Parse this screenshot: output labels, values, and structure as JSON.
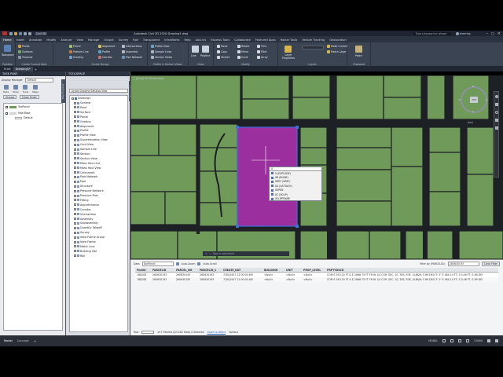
{
  "app": {
    "title": "Autodesk Civil 3D 2020    Drawing1.dwg",
    "search_placeholder": "Type a keyword or phrase",
    "user": "cheerlng",
    "product_badge": "Civil 3D"
  },
  "ribbon_tabs": [
    "Home",
    "Insert",
    "Annotate",
    "Modify",
    "Analyze",
    "View",
    "Manage",
    "Output",
    "Survey",
    "Rail",
    "Transparent",
    "InfraWorks",
    "Help",
    "Add-ins",
    "Express Tools",
    "Collaborate",
    "Featured Apps",
    "Raster Tools",
    "Vehicle Tracking",
    "Geolocation"
  ],
  "ribbon_active_tab": "Home",
  "ribbon": {
    "palettes": {
      "toolspace": "Toolspace",
      "label": "Palettes"
    },
    "ground_data": {
      "items": [
        "Points",
        "Surfaces",
        "Traverse"
      ],
      "label": "Create Ground Data"
    },
    "design": {
      "items": [
        "Parcel",
        "Feature Line",
        "Grading",
        "Alignment",
        "Profile",
        "Corridor",
        "Intersections",
        "Assembly",
        "Pipe Network"
      ],
      "label": "Create Design"
    },
    "profile_section": {
      "items": [
        "Profile View",
        "Sample Lines",
        "Section Views"
      ],
      "label": "Profile & Section Views"
    },
    "draw": {
      "items": [
        "Line",
        "Polyline",
        "Circle",
        "Arc"
      ],
      "label": "Draw"
    },
    "modify": {
      "items": [
        "Move",
        "Copy",
        "Stretch",
        "Rotate",
        "Mirror",
        "Scale",
        "Trim",
        "Fillet",
        "Array"
      ],
      "label": "Modify"
    },
    "layers": {
      "items": [
        "Layer Properties",
        "Make Current",
        "Match Layer"
      ],
      "label": "Layers"
    },
    "clipboard": {
      "items": [
        "Paste"
      ],
      "label": "Clipboard"
    }
  },
  "doc_tabs": [
    "Start",
    "Drawing1*"
  ],
  "taskpane": {
    "title": "TASK PANE",
    "display_manager_label": "Display Manager",
    "map_label": "Default",
    "tools": [
      "Data",
      "Style",
      "Tools",
      "Maps"
    ],
    "buttons": [
      "Groups",
      "Draw Order"
    ],
    "layers": [
      {
        "name": "TaxParcel"
      },
      {
        "name": "Map Base"
      },
      {
        "name": "Default"
      }
    ]
  },
  "toolspace": {
    "title": "TOOLSPACE",
    "view_label": "Active Drawing Settings View",
    "root": "Drawing1",
    "items": [
      "General",
      "Point",
      "Surface",
      "Parcel",
      "Grading",
      "Alignment",
      "Profile",
      "Profile View",
      "Superelevation View",
      "Cant View",
      "Sample Line",
      "Section",
      "Section View",
      "Mass Haul Line",
      "Mass Haul View",
      "Catchment",
      "Pipe Network",
      "Pipe",
      "Structure",
      "Pressure Network",
      "Pressure Pipe",
      "Fitting",
      "Appurtenance",
      "Corridor",
      "Intersection",
      "Assembly",
      "Subassembly",
      "Quantity Takeoff",
      "Survey",
      "View Frame Group",
      "View Frame",
      "Match Line",
      "Building Site",
      "Rail"
    ]
  },
  "viewport": {
    "label": "[-][Top][2D Wireframe]",
    "viewcube": {
      "face": "TOP",
      "n": "N",
      "s": "S",
      "e": "E",
      "w": "W",
      "wcs": "WCS"
    }
  },
  "context_menu": {
    "title": "X",
    "items": [
      "X (EXPLODE)",
      "XB (BLINE)",
      "XREF (XREF)",
      "XA (XATTACH)",
      "XOPEN",
      "XC (XCLIP)",
      "XCLIPFRAME"
    ]
  },
  "command_line": {
    "placeholder": "Type a command"
  },
  "data_table": {
    "label": "Data",
    "layer": "TaxParcel",
    "zoom_label": "Auto-Zoom",
    "scroll_label": "Auto-Scroll",
    "filter_label": "Filter by (PARCELID):",
    "filter_value": "260630193",
    "clear_filter": "Clear Filter",
    "columns": [
      "FeatId",
      "PARCELID",
      "PARCEL_NO",
      "PARCELID_1",
      "CREATE_DAT",
      "BUILDING",
      "UNIT",
      "PROP_LEVEL",
      "PRPTYDSCR"
    ],
    "rows": [
      [
        "188208",
        "260630193",
        "260630193",
        "260630193",
        "7/30/2007 12:00:00 AM",
        "<Null>",
        "<Null>",
        "<Null>",
        "COM E 550.20 FT & E 2668.75 FT FR W 1/4 COR. SEC. 10, T8S, R3E, SLB&M; S 89 DEG 3' 3\" E 484.14 FT; S 0.46 FT; S 89 DEG 1"
      ],
      [
        "188208",
        "260630193",
        "260630193",
        "260630193",
        "7/30/2007 12:00:00 AM",
        "<Null>",
        "<Null>",
        "<Null>",
        "COM E 550.20 FT & E 2668.75 FT FR W 1/4 COR. SEC. 10, T8S, R3E, SLB&M; S 89 DEG 3' 3\" E 484.14 FT; S 0.46 FT; S 89 DEG 1"
      ]
    ],
    "footer": {
      "row_label": "Row",
      "record_info": "of 2 Filtered (221182 Total)   0 Selected",
      "zoom_select": "Zoom to Select",
      "options": "Options"
    }
  },
  "status": {
    "model_tab": "Model",
    "layout_tab": "Concept",
    "mode": "MODEL",
    "scale": "3.5000"
  },
  "colors": {
    "parcel_green": "#6f9a5a",
    "road": "#24272b",
    "highlight": "#9b2f9d",
    "selection_blue": "#3f6fd8",
    "ribbon_bg": "#3b4453",
    "accent": "#e8a33b"
  }
}
